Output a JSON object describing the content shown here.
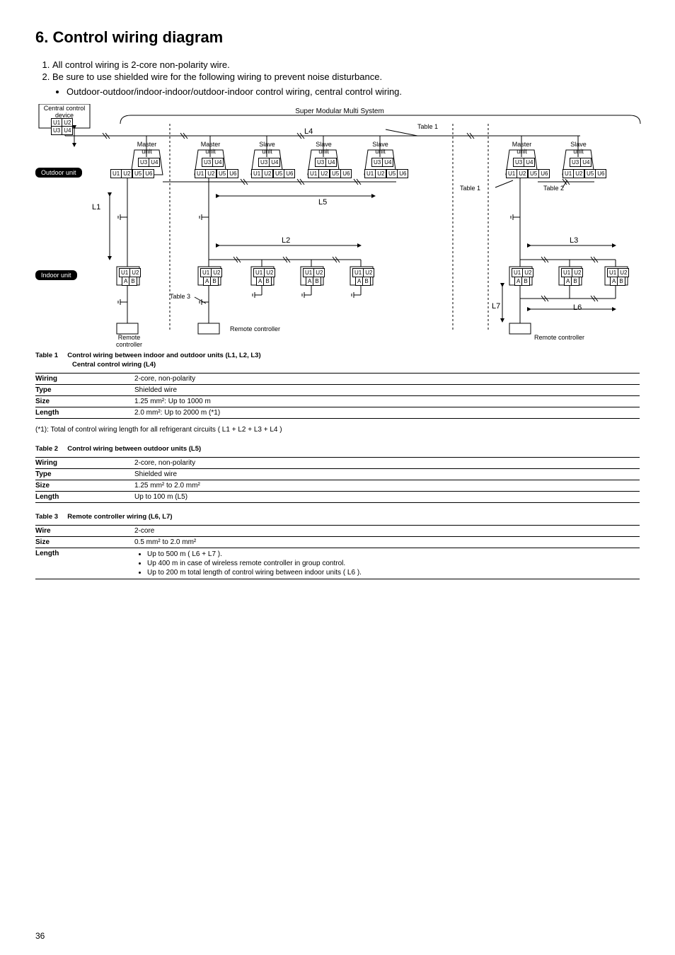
{
  "page_number": "36",
  "heading": "6.  Control wiring diagram",
  "intro": {
    "item1": "All control wiring is 2-core non-polarity wire.",
    "item2": "Be sure to use shielded wire for the following wiring to prevent noise disturbance.",
    "sub1": "Outdoor-outdoor/indoor-indoor/outdoor-indoor control wiring, central control wiring."
  },
  "diagram": {
    "central_control": "Central control device",
    "system_title": "Super Modular Multi System",
    "outdoor_badge": "Outdoor unit",
    "indoor_badge": "Indoor unit",
    "master": "Master unit",
    "slave": "Slave unit",
    "remote": "Remote controller",
    "L1": "L1",
    "L2": "L2",
    "L3": "L3",
    "L4": "L4",
    "L5": "L5",
    "L6": "L6",
    "L7": "L7",
    "table1": "Table 1",
    "table2": "Table 2",
    "table3": "Table 3",
    "U1U2": "U1|U2",
    "U3U4": "U3|U4",
    "U5U6": "U5|U6",
    "AB": "A|B"
  },
  "table1": {
    "caption": "Table 1",
    "subtitle_line1": "Control wiring between indoor and outdoor units (L1, L2, L3)",
    "subtitle_line2": "Central control wiring (L4)",
    "rows": {
      "wiring_k": "Wiring",
      "wiring_v": "2-core, non-polarity",
      "type_k": "Type",
      "type_v": "Shielded wire",
      "size_k": "Size",
      "size_v": "1.25 mm²: Up to 1000 m",
      "length_k": "Length",
      "length_v": "2.0 mm²: Up to 2000 m  (*1)"
    }
  },
  "footnote": "(*1):   Total of control wiring length for all refrigerant circuits ( L1 + L2 + L3 + L4 )",
  "table2": {
    "caption": "Table 2",
    "subtitle": "Control wiring between outdoor units (L5)",
    "rows": {
      "wiring_k": "Wiring",
      "wiring_v": "2-core, non-polarity",
      "type_k": "Type",
      "type_v": "Shielded wire",
      "size_k": "Size",
      "size_v": "1.25 mm² to 2.0 mm²",
      "length_k": "Length",
      "length_v": "Up to 100 m (L5)"
    }
  },
  "table3": {
    "caption": "Table 3",
    "subtitle": "Remote controller wiring (L6, L7)",
    "rows": {
      "wire_k": "Wire",
      "wire_v": "2-core",
      "size_k": "Size",
      "size_v": "0.5 mm² to 2.0 mm²",
      "length_k": "Length",
      "len1": "Up to 500 m ( L6 + L7 ).",
      "len2": "Up 400 m in case of wireless remote controller in group control.",
      "len3": "Up to 200 m total length of control wiring between indoor units ( L6 )."
    }
  },
  "chart_data": {
    "type": "diagram",
    "title": "Control wiring diagram — Super Modular Multi System",
    "blocks": {
      "central_control_device": {
        "terminals": [
          "U1",
          "U2",
          "U3",
          "U4"
        ]
      },
      "outdoor_groups": [
        {
          "group": 1,
          "units": [
            {
              "role": "Master",
              "terminals": [
                "U3",
                "U4",
                "U1",
                "U2",
                "U5",
                "U6"
              ]
            }
          ]
        },
        {
          "group": 2,
          "units": [
            {
              "role": "Master",
              "terminals": [
                "U3",
                "U4",
                "U1",
                "U2",
                "U5",
                "U6"
              ]
            },
            {
              "role": "Slave",
              "terminals": [
                "U3",
                "U4",
                "U1",
                "U2",
                "U5",
                "U6"
              ]
            },
            {
              "role": "Slave",
              "terminals": [
                "U3",
                "U4",
                "U1",
                "U2",
                "U5",
                "U6"
              ]
            },
            {
              "role": "Slave",
              "terminals": [
                "U3",
                "U4",
                "U1",
                "U2",
                "U5",
                "U6"
              ]
            }
          ]
        },
        {
          "group": 3,
          "units": [
            {
              "role": "Master",
              "terminals": [
                "U3",
                "U4",
                "U1",
                "U2",
                "U5",
                "U6"
              ]
            },
            {
              "role": "Slave",
              "terminals": [
                "U3",
                "U4",
                "U1",
                "U2",
                "U5",
                "U6"
              ]
            }
          ]
        }
      ],
      "indoor_groups": [
        {
          "group": 1,
          "units": 1,
          "terminals_each": [
            "U1",
            "U2",
            "A",
            "B"
          ],
          "remote_controllers": 1
        },
        {
          "group": 2,
          "units": 4,
          "terminals_each": [
            "U1",
            "U2",
            "A",
            "B"
          ],
          "remote_controllers": 1
        },
        {
          "group": 3,
          "units": 3,
          "terminals_each": [
            "U1",
            "U2",
            "A",
            "B"
          ],
          "remote_controllers": 1
        }
      ]
    },
    "lines": {
      "L1": "Outdoor master (group 1) → indoor unit (group 1)",
      "L2": "Outdoor master (group 2) → indoor chain (group 2)",
      "L3": "Outdoor master (group 3) → indoor chain (group 3)",
      "L4": "Central control device → outdoor masters (U3/U4 bus)",
      "L5": "Between outdoor units in a header group (U5/U6)",
      "L6": "Between indoor units in a group (A/B)",
      "L7": "Indoor unit → remote controller (A/B)"
    },
    "table_references": {
      "Table 1": [
        "L1",
        "L2",
        "L3",
        "L4"
      ],
      "Table 2": [
        "L5"
      ],
      "Table 3": [
        "L6",
        "L7"
      ]
    }
  }
}
